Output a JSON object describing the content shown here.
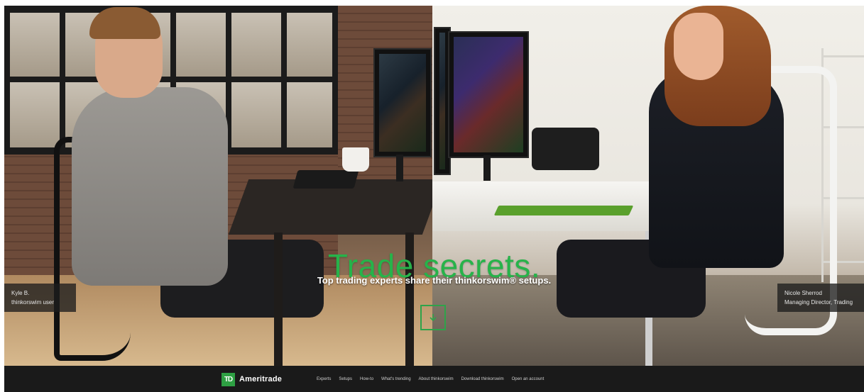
{
  "hero": {
    "headline": "Trade secrets.",
    "subheadline": "Top trading experts share their thinkorswim® setups.",
    "caption_left": {
      "name": "Kyle B.",
      "role": "thinkorswim user"
    },
    "caption_right": {
      "name": "Nicole Sherrod",
      "role": "Managing Director, Trading"
    },
    "scroll_icon": "down-arrow-icon"
  },
  "nav": {
    "logo_mark": "TD",
    "brand_name": "Ameritrade",
    "links": [
      "Experts",
      "Setups",
      "How-to",
      "What's trending",
      "About thinkorswim",
      "Download thinkorswim",
      "Open an account"
    ]
  },
  "colors": {
    "accent_green": "#27b34a",
    "nav_background": "#1a1a1a"
  }
}
